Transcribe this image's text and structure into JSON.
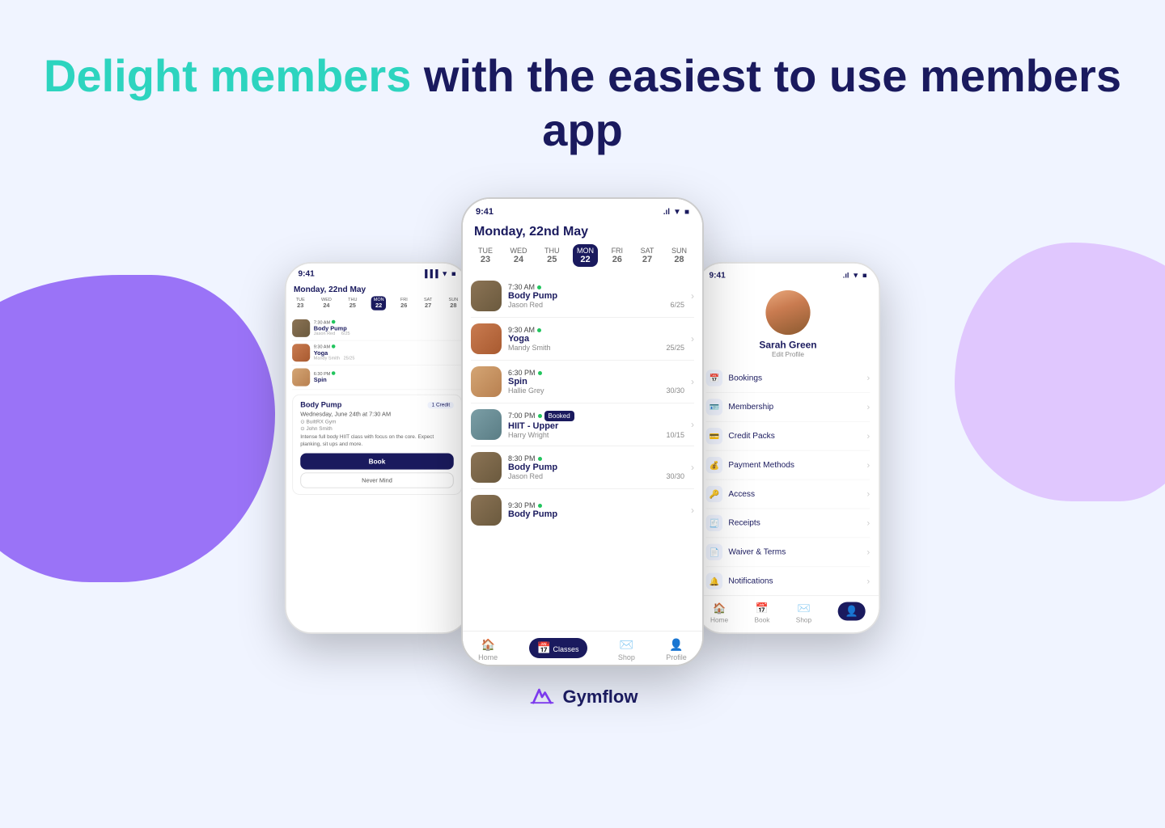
{
  "header": {
    "highlight": "Delight members",
    "rest": "with the easiest to use members app"
  },
  "front_phone": {
    "status_time": "9:41",
    "date_label": "Monday, 22nd May",
    "days": [
      {
        "label": "TUE",
        "num": "23",
        "active": false
      },
      {
        "label": "WED",
        "num": "24",
        "active": false
      },
      {
        "label": "THU",
        "num": "25",
        "active": false
      },
      {
        "label": "MON",
        "num": "22",
        "active": true
      },
      {
        "label": "FRI",
        "num": "26",
        "active": false
      },
      {
        "label": "SAT",
        "num": "27",
        "active": false
      },
      {
        "label": "SUN",
        "num": "28",
        "active": false
      }
    ],
    "classes": [
      {
        "time": "7:30 AM",
        "name": "Body Pump",
        "trainer": "Jason Red",
        "capacity": "6/25",
        "booked": false,
        "av": "av1"
      },
      {
        "time": "9:30 AM",
        "name": "Yoga",
        "trainer": "Mandy Smith",
        "capacity": "25/25",
        "booked": false,
        "av": "av2"
      },
      {
        "time": "6:30 PM",
        "name": "Spin",
        "trainer": "Hallie Grey",
        "capacity": "30/30",
        "booked": false,
        "av": "av3"
      },
      {
        "time": "7:00 PM",
        "name": "HIIT - Upper",
        "trainer": "Harry Wright",
        "capacity": "10/15",
        "booked": true,
        "av": "av4"
      },
      {
        "time": "8:30 PM",
        "name": "Body Pump",
        "trainer": "Jason Red",
        "capacity": "30/30",
        "booked": false,
        "av": "av1"
      },
      {
        "time": "9:30 PM",
        "name": "Body Pump",
        "trainer": "",
        "capacity": "",
        "booked": false,
        "av": "av5"
      }
    ],
    "nav": [
      {
        "label": "Home",
        "icon": "🏠",
        "active": false
      },
      {
        "label": "Classes",
        "icon": "📅",
        "active": true
      },
      {
        "label": "Shop",
        "icon": "✉️",
        "active": false
      },
      {
        "label": "Profile",
        "icon": "👤",
        "active": false
      }
    ]
  },
  "back_left_phone": {
    "status_time": "9:41",
    "date_label": "Monday, 22nd May",
    "days": [
      {
        "label": "TUE",
        "num": "23",
        "active": false
      },
      {
        "label": "WED",
        "num": "24",
        "active": false
      },
      {
        "label": "THU",
        "num": "25",
        "active": false
      },
      {
        "label": "MON",
        "num": "22",
        "active": true
      },
      {
        "label": "FRI",
        "num": "26",
        "active": false
      },
      {
        "label": "SAT",
        "num": "27",
        "active": false
      },
      {
        "label": "SUN",
        "num": "28",
        "active": false
      }
    ],
    "classes": [
      {
        "time": "7:30 AM",
        "name": "Body Pump",
        "trainer": "Jason Red",
        "capacity": "6/25",
        "av": "av1"
      },
      {
        "time": "9:30 AM",
        "name": "Yoga",
        "trainer": "Mandy Smith",
        "capacity": "25/25",
        "av": "av2"
      },
      {
        "time": "6:30 PM",
        "name": "Spin",
        "trainer": "",
        "capacity": "",
        "av": "av3"
      }
    ],
    "detail": {
      "class_name": "Body Pump",
      "credit": "1 Credit",
      "date": "Wednesday, June 24th at 7:30 AM",
      "gym": "BuiltRX Gym",
      "trainer": "John Smith",
      "desc": "Intense full body HIIT class with focus on the core. Expect planking, sit ups and more.",
      "book_btn": "Book",
      "nevermind_btn": "Never Mind"
    }
  },
  "back_right_phone": {
    "status_time": "9:41",
    "profile": {
      "name": "Sarah Green",
      "edit": "Edit Profile"
    },
    "menu": [
      {
        "icon": "📅",
        "label": "Bookings"
      },
      {
        "icon": "🪪",
        "label": "Membership"
      },
      {
        "icon": "💳",
        "label": "Credit Packs"
      },
      {
        "icon": "💰",
        "label": "Payment Methods"
      },
      {
        "icon": "🔑",
        "label": "Access"
      },
      {
        "icon": "🧾",
        "label": "Receipts"
      },
      {
        "icon": "📄",
        "label": "Waiver & Terms"
      },
      {
        "icon": "🔔",
        "label": "Notifications"
      }
    ],
    "nav": [
      {
        "label": "Home",
        "icon": "🏠",
        "active": false
      },
      {
        "label": "Book",
        "icon": "📅",
        "active": false
      },
      {
        "label": "Shop",
        "icon": "✉️",
        "active": false
      },
      {
        "label": "Profile",
        "icon": "👤",
        "active": true
      }
    ]
  },
  "footer": {
    "brand": "Gymflow"
  }
}
